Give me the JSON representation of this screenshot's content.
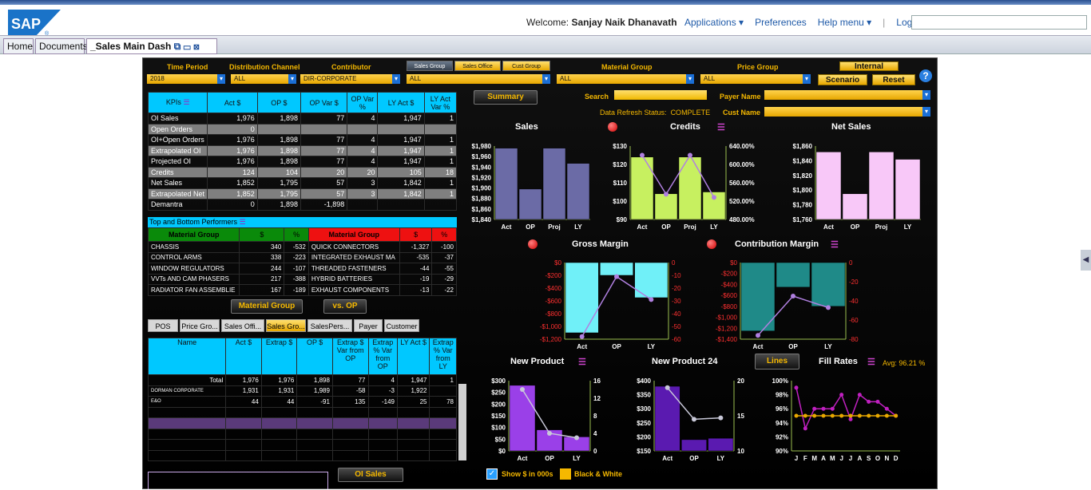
{
  "header": {
    "logo_text": "SAP",
    "welcome_prefix": "Welcome:",
    "user_name": "Sanjay Naik Dhanavath",
    "links": [
      "Applications ▾",
      "Preferences",
      "Help menu ▾",
      "|",
      "Log off"
    ],
    "search_value": ""
  },
  "tabs": {
    "items": [
      "Home",
      "Documents",
      "_Sales Main Dash"
    ]
  },
  "filters": {
    "time_period_label": "Time Period",
    "time_period": "2018",
    "dist_label": "Distribution Channel",
    "dist_value": "ALL",
    "contrib_label": "Contributor",
    "contrib_value": "DIR-CORPORATE",
    "sales_tabs": [
      "Sales Group",
      "Sales Office",
      "Cust Group"
    ],
    "sales_value": "ALL",
    "material_label": "Material Group",
    "material_value": "ALL",
    "price_label": "Price Group",
    "price_value": "ALL",
    "internal": "Internal",
    "scenario": "Scenario",
    "reset": "Reset",
    "help": "?"
  },
  "summary": {
    "button": "Summary",
    "search_label": "Search",
    "payer_label": "Payer Name",
    "refresh_label": "Data Refresh Status:",
    "refresh_value": "COMPLETE",
    "cust_label": "Cust Name"
  },
  "kpi": {
    "headers": [
      "KPIs",
      "Act $",
      "OP $",
      "OP Var $",
      "OP Var %",
      "LY Act $",
      "LY Act Var %"
    ],
    "rows": [
      [
        "OI Sales",
        "1,976",
        "1,898",
        "77",
        "4",
        "1,947",
        "1"
      ],
      [
        "Open Orders",
        "0",
        "",
        "",
        "",
        "",
        ""
      ],
      [
        "OI+Open Orders",
        "1,976",
        "1,898",
        "77",
        "4",
        "1,947",
        "1"
      ],
      [
        "Extrapolated OI",
        "1,976",
        "1,898",
        "77",
        "4",
        "1,947",
        "1"
      ],
      [
        "Projected OI",
        "1,976",
        "1,898",
        "77",
        "4",
        "1,947",
        "1"
      ],
      [
        "Credits",
        "124",
        "104",
        "20",
        "20",
        "105",
        "18"
      ],
      [
        "Net Sales",
        "1,852",
        "1,795",
        "57",
        "3",
        "1,842",
        "1"
      ],
      [
        "Extrapolated Net",
        "1,852",
        "1,795",
        "57",
        "3",
        "1,842",
        "1"
      ],
      [
        "Demantra",
        "0",
        "1,898",
        "-1,898",
        "",
        "",
        ""
      ]
    ]
  },
  "performers": {
    "title": "Top and Bottom Performers",
    "top_headers": [
      "Material Group",
      "$",
      "%"
    ],
    "bot_headers": [
      "Material Group",
      "$",
      "%"
    ],
    "top": [
      [
        "CHASSIS",
        "340",
        "-532"
      ],
      [
        "CONTROL ARMS",
        "338",
        "-223"
      ],
      [
        "WINDOW REGULATORS",
        "244",
        "-107"
      ],
      [
        "VVTs AND CAM PHASERS",
        "217",
        "-388"
      ],
      [
        "RADIATOR FAN ASSEMBLIE",
        "167",
        "-189"
      ]
    ],
    "bottom": [
      [
        "QUICK CONNECTORS",
        "-1,327",
        "-100"
      ],
      [
        "INTEGRATED EXHAUST MA",
        "-535",
        "-37"
      ],
      [
        "THREADED FASTENERS",
        "-44",
        "-55"
      ],
      [
        "HYBRID BATTERIES",
        "-19",
        "-29"
      ],
      [
        "EXHAUST COMPONENTS",
        "-13",
        "-22"
      ]
    ],
    "btn1": "Material Group",
    "btn2": "vs. OP"
  },
  "bottom_tabs": {
    "items": [
      "POS",
      "Price Gro...",
      "Sales Offi...",
      "Sales Gro...",
      "SalesPers...",
      "Payer",
      "Customer"
    ]
  },
  "detail": {
    "headers": [
      "Name",
      "Act $",
      "Extrap $",
      "OP $",
      "Extrap $ Var from OP",
      "Extrap % Var from OP",
      "LY Act $",
      "Extrap % Var from LY"
    ],
    "rows": [
      [
        "Total",
        "1,976",
        "1,976",
        "1,898",
        "77",
        "4",
        "1,947",
        "1"
      ],
      [
        "DORMAN CORPORATE",
        "1,931",
        "1,931",
        "1,989",
        "-58",
        "-3",
        "1,922",
        ""
      ],
      [
        "E&O",
        "44",
        "44",
        "-91",
        "135",
        "-149",
        "25",
        "78"
      ]
    ],
    "oi_button": "OI Sales"
  },
  "charts": {
    "sales_title": "Sales",
    "credits_title": "Credits",
    "net_title": "Net Sales",
    "gm_title": "Gross Margin",
    "cm_title": "Contribution Margin",
    "np_title": "New Product",
    "np24_title": "New Product 24",
    "lines_btn": "Lines",
    "fill_title": "Fill Rates",
    "fill_avg": "Avg: 96.21 %"
  },
  "chart_data": [
    {
      "type": "bar",
      "title": "Sales",
      "categories": [
        "Act",
        "OP",
        "Proj",
        "LY"
      ],
      "values": [
        1976,
        1898,
        1976,
        1947
      ],
      "ylim": [
        1840,
        1980
      ],
      "yticks": [
        "$1,980",
        "$1,960",
        "$1,940",
        "$1,920",
        "$1,900",
        "$1,880",
        "$1,860",
        "$1,840"
      ]
    },
    {
      "type": "bar",
      "title": "Credits",
      "categories": [
        "Act",
        "OP",
        "Proj",
        "LY"
      ],
      "values": [
        124,
        104,
        124,
        105
      ],
      "line": [
        620,
        535,
        620,
        528
      ],
      "ylim": [
        90,
        130
      ],
      "yticks": [
        "$130",
        "$120",
        "$110",
        "$100",
        "$90"
      ],
      "y2ticks": [
        "640.00%",
        "600.00%",
        "560.00%",
        "520.00%",
        "480.00%"
      ]
    },
    {
      "type": "bar",
      "title": "Net Sales",
      "categories": [
        "Act",
        "OP",
        "Proj",
        "LY"
      ],
      "values": [
        1852,
        1795,
        1852,
        1842
      ],
      "ylim": [
        1760,
        1860
      ],
      "yticks": [
        "$1,860",
        "$1,840",
        "$1,820",
        "$1,800",
        "$1,780",
        "$1,760"
      ]
    },
    {
      "type": "bar",
      "title": "Gross Margin",
      "categories": [
        "Act",
        "OP",
        "LY"
      ],
      "values": [
        -1100,
        -200,
        -550
      ],
      "line": [
        -58,
        -11,
        -29
      ],
      "ylim": [
        -1200,
        0
      ],
      "yticks": [
        "$0",
        "-$200",
        "-$400",
        "-$600",
        "-$800",
        "-$1,000",
        "-$1,200"
      ],
      "y2ticks": [
        "0",
        "-10",
        "-20",
        "-30",
        "-40",
        "-50",
        "-60"
      ]
    },
    {
      "type": "bar",
      "title": "Contribution Margin",
      "categories": [
        "Act",
        "OP",
        "LY"
      ],
      "values": [
        -1250,
        -450,
        -800
      ],
      "line": [
        -76,
        -35,
        -47
      ],
      "ylim": [
        -1400,
        0
      ],
      "yticks": [
        "$0",
        "-$200",
        "-$400",
        "-$600",
        "-$800",
        "-$1,000",
        "-$1,200",
        "-$1,400"
      ],
      "y2ticks": [
        "0",
        "-20",
        "-40",
        "-60",
        "-80"
      ]
    },
    {
      "type": "bar",
      "title": "New Product",
      "categories": [
        "Act",
        "OP",
        "LY"
      ],
      "values": [
        280,
        90,
        60
      ],
      "line": [
        14,
        4,
        3
      ],
      "ylim": [
        0,
        300
      ],
      "yticks": [
        "$300",
        "$250",
        "$200",
        "$150",
        "$100",
        "$50",
        "$0"
      ],
      "y2ticks": [
        "16",
        "12",
        "8",
        "4",
        "0"
      ]
    },
    {
      "type": "bar",
      "title": "New Product 24",
      "categories": [
        "Act",
        "OP",
        "LY"
      ],
      "values": [
        380,
        190,
        195
      ],
      "line": [
        19,
        14.5,
        14.7
      ],
      "ylim": [
        150,
        400
      ],
      "yticks": [
        "$400",
        "$350",
        "$300",
        "$250",
        "$200",
        "$150"
      ],
      "y2ticks": [
        "20",
        "15",
        "10"
      ]
    },
    {
      "type": "line",
      "title": "Fill Rates",
      "categories": [
        "J",
        "F",
        "M",
        "A",
        "M",
        "J",
        "J",
        "A",
        "S",
        "O",
        "N",
        "D"
      ],
      "series": [
        {
          "values": [
            99,
            93.2,
            96,
            96,
            96,
            98,
            94.5,
            98,
            97,
            97,
            96,
            95
          ]
        },
        {
          "values": [
            95,
            95,
            95,
            95,
            95,
            95,
            95,
            95,
            95,
            95,
            95,
            95
          ]
        }
      ],
      "ylim": [
        90,
        100
      ],
      "yticks": [
        "100%",
        "98%",
        "96%",
        "94%",
        "92%",
        "90%"
      ]
    }
  ],
  "footer": {
    "show000": "Show $ in 000s",
    "bw": "Black & White"
  }
}
